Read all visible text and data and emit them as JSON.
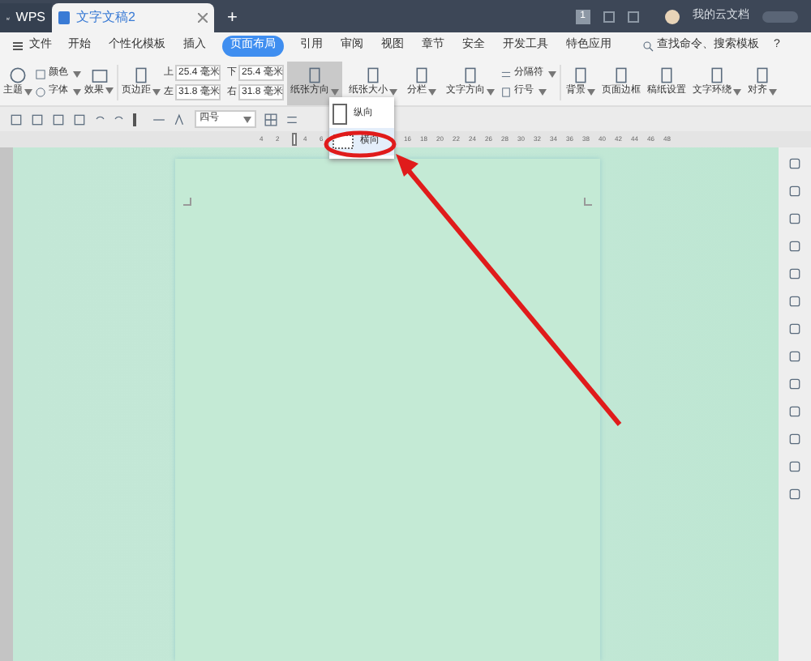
{
  "title_bar": {
    "tabs": [
      {
        "label": "WPS",
        "kind": "home",
        "selected": false
      },
      {
        "label": "文字文稿2",
        "kind": "doc",
        "selected": true
      }
    ],
    "add_tab": "+",
    "page_count": "1",
    "user": "我的云文档"
  },
  "menu": {
    "file": "文件",
    "items": [
      {
        "label": "开始",
        "selected": false
      },
      {
        "label": "个性化模板",
        "selected": false
      },
      {
        "label": "插入",
        "selected": false
      },
      {
        "label": "页面布局",
        "selected": true
      },
      {
        "label": "引用",
        "selected": false
      },
      {
        "label": "审阅",
        "selected": false
      },
      {
        "label": "视图",
        "selected": false
      },
      {
        "label": "章节",
        "selected": false
      },
      {
        "label": "安全",
        "selected": false
      },
      {
        "label": "开发工具",
        "selected": false
      },
      {
        "label": "特色应用",
        "selected": false
      }
    ],
    "search": "查找命令、搜索模板",
    "help": "?"
  },
  "ribbon": {
    "theme": "主题",
    "colors": "颜色",
    "fonts": "字体",
    "effects": "效果",
    "margins": "页边距",
    "margin_fields": [
      {
        "label": "上",
        "value": "25.4 毫米"
      },
      {
        "label": "下",
        "value": "25.4 毫米"
      },
      {
        "label": "左",
        "value": "31.8 毫米"
      },
      {
        "label": "右",
        "value": "31.8 毫米"
      }
    ],
    "buttons": [
      {
        "label": "纸张方向",
        "pressed": true,
        "dropdown": true
      },
      {
        "label": "纸张大小",
        "pressed": false,
        "dropdown": true
      },
      {
        "label": "分栏",
        "pressed": false,
        "dropdown": true
      },
      {
        "label": "文字方向",
        "pressed": false,
        "dropdown": true
      }
    ],
    "separator": "分隔符",
    "line_numbers": "行号",
    "right_buttons": [
      {
        "label": "背景",
        "dropdown": true
      },
      {
        "label": "页面边框",
        "dropdown": false
      },
      {
        "label": "稿纸设置",
        "dropdown": false
      },
      {
        "label": "文字环绕",
        "dropdown": true
      },
      {
        "label": "对齐",
        "dropdown": true
      }
    ]
  },
  "quick_toolbar": {
    "font_size": "四号"
  },
  "ruler": {
    "left_ticks": [
      "4",
      "2"
    ],
    "right_ticks": [
      "4",
      "6"
    ],
    "far_ticks": [
      "16",
      "18",
      "20",
      "22",
      "24",
      "26",
      "28",
      "30",
      "32",
      "34",
      "36",
      "38",
      "40",
      "42",
      "44",
      "46",
      "48"
    ]
  },
  "orientation_menu": {
    "items": [
      {
        "label": "纵向",
        "kind": "portrait",
        "selected": false
      },
      {
        "label": "横向",
        "kind": "landscape",
        "selected": true
      }
    ]
  }
}
